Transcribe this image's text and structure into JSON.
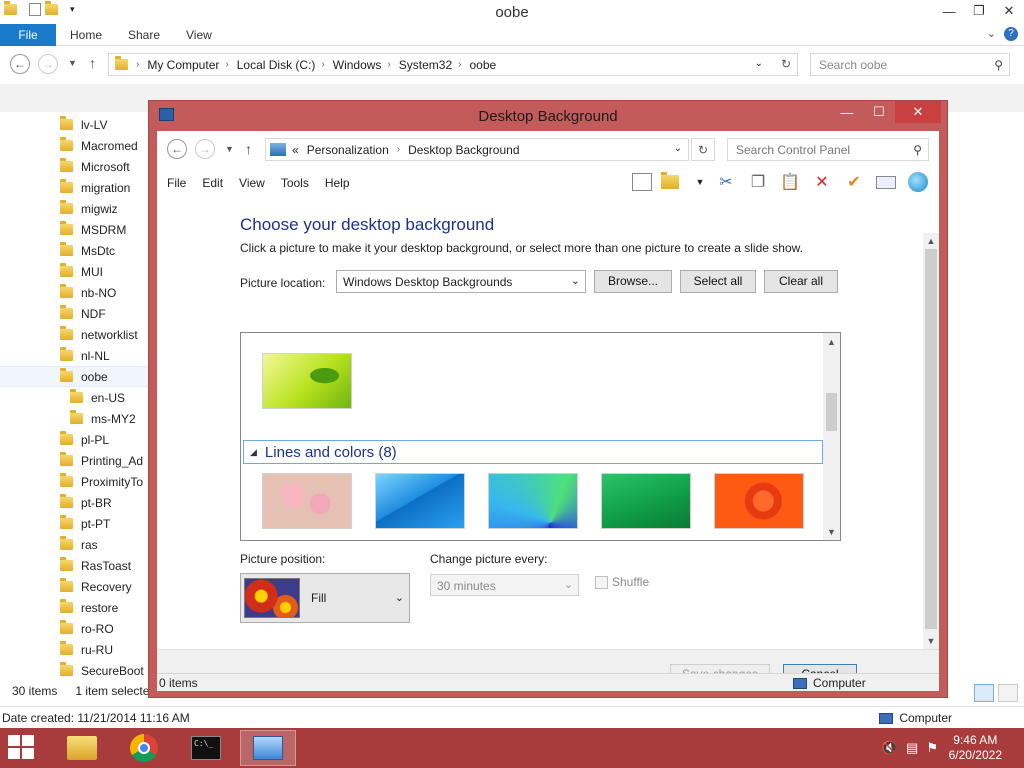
{
  "explorer": {
    "title": "oobe",
    "ribbon_tabs": {
      "file": "File",
      "home": "Home",
      "share": "Share",
      "view": "View"
    },
    "breadcrumb": [
      "My Computer",
      "Local Disk (C:)",
      "Windows",
      "System32",
      "oobe"
    ],
    "search_placeholder": "Search oobe",
    "folders": [
      "lv-LV",
      "Macromed",
      "Microsoft",
      "migration",
      "migwiz",
      "MSDRM",
      "MsDtc",
      "MUI",
      "nb-NO",
      "NDF",
      "networklist",
      "nl-NL",
      "oobe",
      "en-US",
      "ms-MY2",
      "pl-PL",
      "Printing_Ad",
      "ProximityTo",
      "pt-BR",
      "pt-PT",
      "ras",
      "RasToast",
      "Recovery",
      "restore",
      "ro-RO",
      "ru-RU",
      "SecureBoot"
    ],
    "status": {
      "items": "30 items",
      "selected": "1 item selecte"
    },
    "details": {
      "date_created": "Date created: 11/21/2014 11:16 AM",
      "computer": "Computer"
    }
  },
  "dialog": {
    "title": "Desktop Background",
    "breadcrumb": {
      "prefix": "«",
      "items": [
        "Personalization",
        "Desktop Background"
      ]
    },
    "search_placeholder": "Search Control Panel",
    "menu": [
      "File",
      "Edit",
      "View",
      "Tools",
      "Help"
    ],
    "heading": "Choose your desktop background",
    "description": "Click a picture to make it your desktop background, or select more than one picture to create a slide show.",
    "picture_location_label": "Picture location:",
    "picture_location_value": "Windows Desktop Backgrounds",
    "browse_label": "Browse...",
    "select_all_label": "Select all",
    "clear_all_label": "Clear all",
    "group_header": "Lines and colors (8)",
    "picture_position_label": "Picture position:",
    "picture_position_value": "Fill",
    "change_picture_label": "Change picture every:",
    "change_picture_value": "30 minutes",
    "shuffle_label": "Shuffle",
    "save_label": "Save changes",
    "cancel_label": "Cancel",
    "status_items": "0 items",
    "status_computer": "Computer"
  },
  "taskbar": {
    "time": "9:46 AM",
    "date": "6/20/2022"
  },
  "colors": {
    "dialog_frame": "#c45b5b",
    "taskbar": "#a83c3c",
    "heading": "#1e3287",
    "file_tab": "#1979ca"
  }
}
